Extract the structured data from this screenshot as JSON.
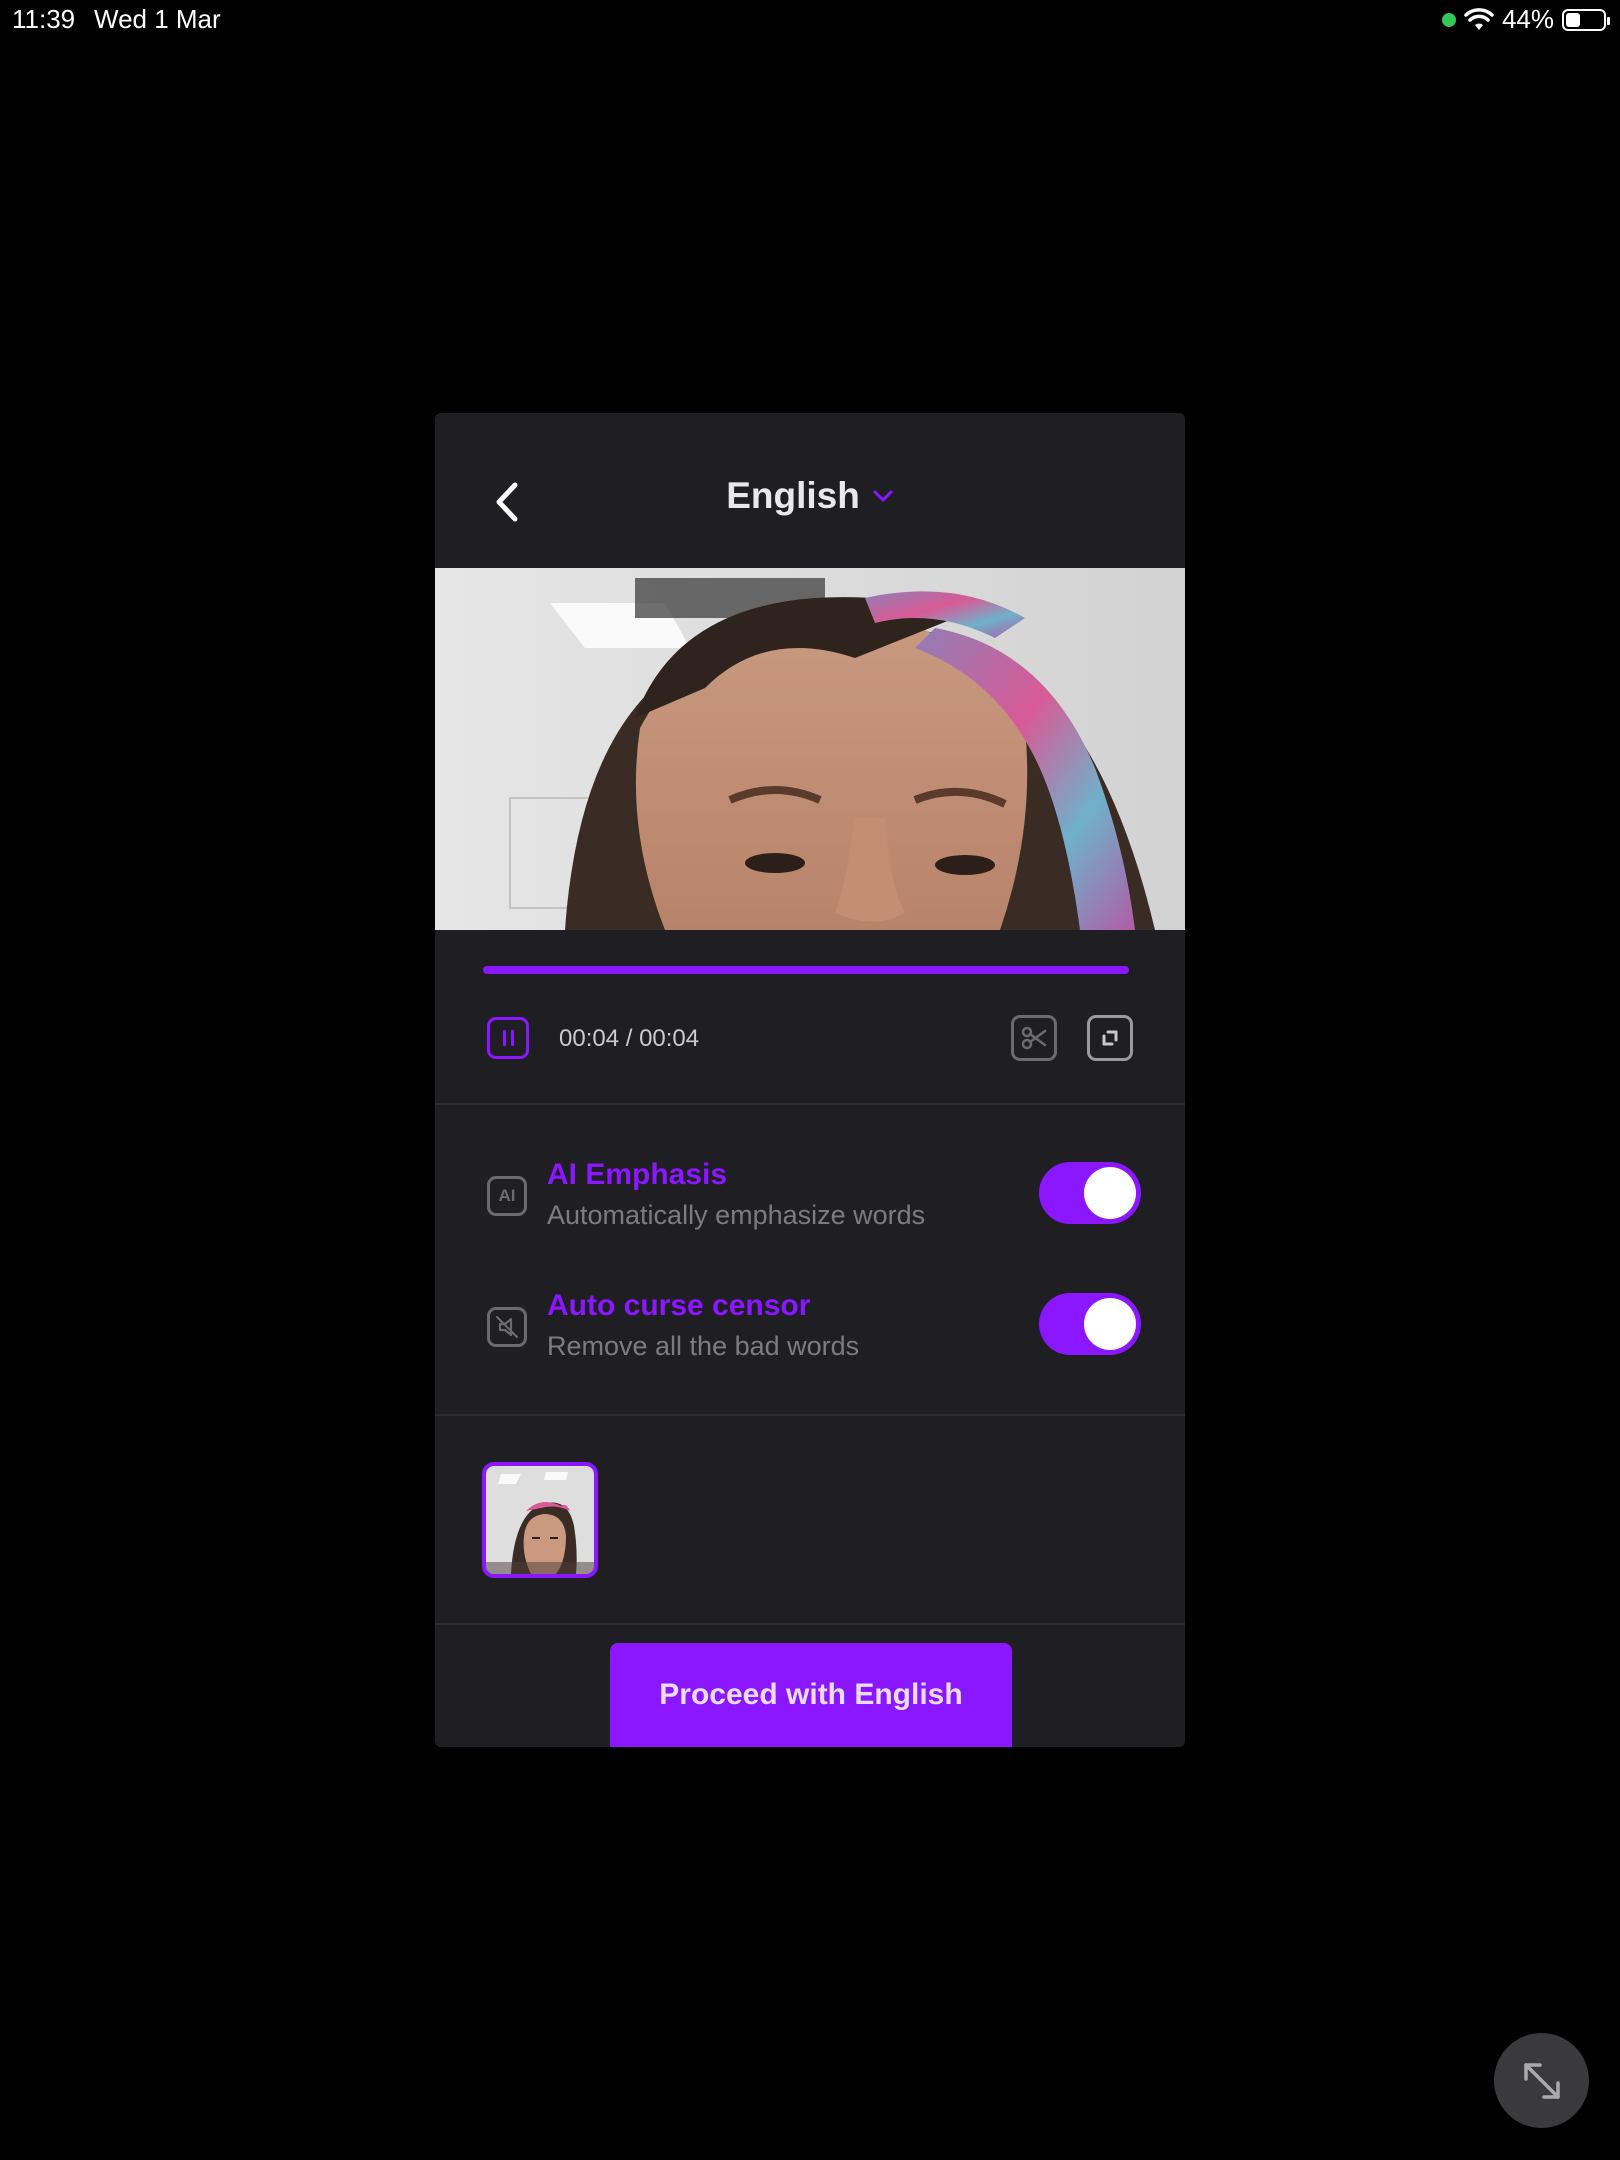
{
  "status_bar": {
    "time": "11:39",
    "date": "Wed 1 Mar",
    "battery_text": "44%",
    "battery_level": 0.44,
    "icons": [
      "camera-in-use-dot",
      "wifi-icon",
      "battery-icon"
    ]
  },
  "header": {
    "language": "English",
    "back_icon": "chevron-left-icon",
    "dropdown_icon": "chevron-down-icon"
  },
  "player": {
    "progress": 1.0,
    "time": "00:04 / 00:04",
    "icons": [
      "pause-icon",
      "scissors-icon",
      "expand-icon"
    ]
  },
  "options": [
    {
      "icon": "AI",
      "title": "AI Emphasis",
      "subtitle": "Automatically emphasize words",
      "enabled": true
    },
    {
      "icon": "mute-speaker-icon",
      "title": "Auto curse censor",
      "subtitle": "Remove all the bad words",
      "enabled": true
    }
  ],
  "proceed_button": "Proceed with English",
  "colors": {
    "accent": "#8a17ff",
    "panel": "#1f1f23",
    "background": "#000000"
  }
}
